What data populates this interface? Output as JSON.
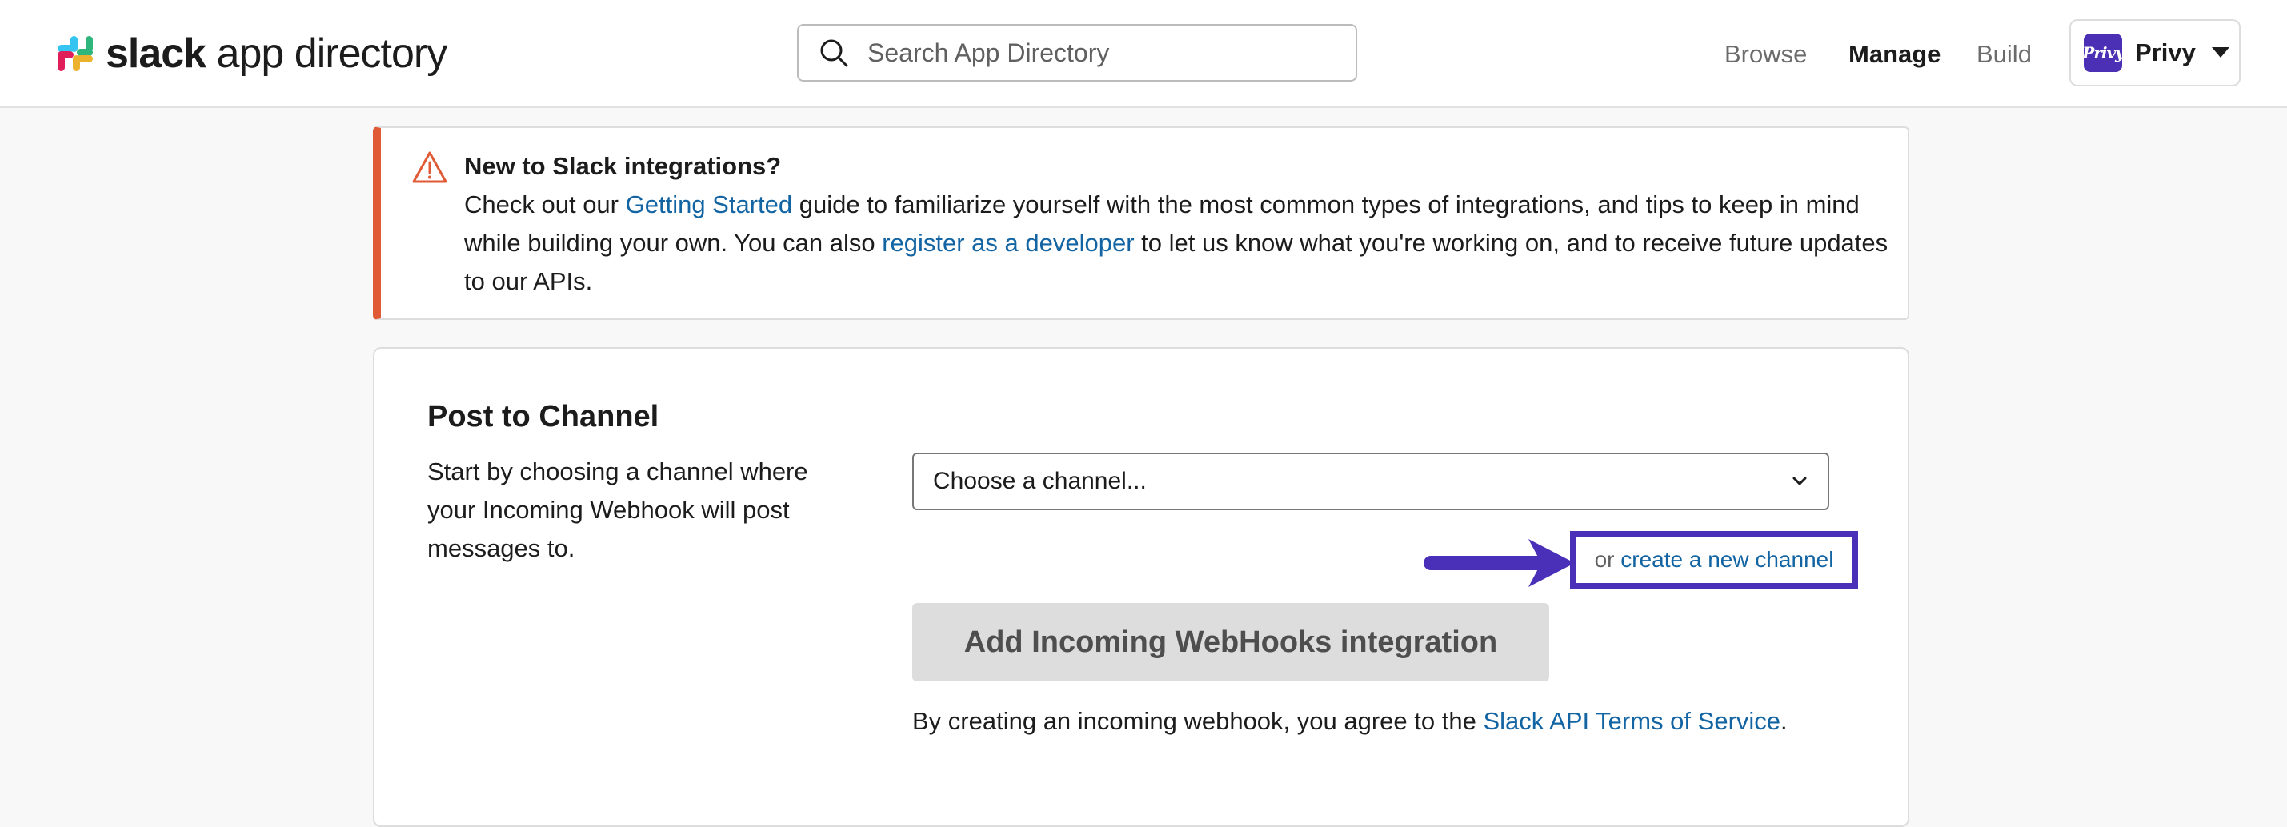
{
  "header": {
    "brand_bold": "slack",
    "brand_rest": " app directory",
    "search_placeholder": "Search App Directory",
    "nav": {
      "browse": "Browse",
      "manage": "Manage",
      "build": "Build",
      "active": "manage"
    },
    "workspace": {
      "avatar_text": "Privy",
      "name": "Privy"
    }
  },
  "alert": {
    "title": "New to Slack integrations?",
    "text_1": "Check out our ",
    "link_getting_started": "Getting Started",
    "text_2": " guide to familiarize yourself with the most common types of integrations, and tips to keep in mind while building your own. You can also ",
    "link_register": "register as a developer",
    "text_3": " to let us know what you're working on, and to receive future updates to our APIs.",
    "accent_color": "#e05a35"
  },
  "post_to_channel": {
    "title": "Post to Channel",
    "description": "Start by choosing a channel where your Incoming Webhook will post messages to.",
    "select_placeholder": "Choose a channel...",
    "create_prefix": "or ",
    "create_link": "create a new channel",
    "add_button": "Add Incoming WebHooks integration",
    "terms_prefix": "By creating an incoming webhook, you agree to the ",
    "terms_link": "Slack API Terms of Service",
    "terms_suffix": "."
  },
  "colors": {
    "link": "#1264a3",
    "highlight": "#4a2fb8",
    "workspace_avatar": "#4b2fb5",
    "button_disabled": "#dddddd"
  },
  "icons": {
    "brand": "slack-logo-icon",
    "search": "search-icon",
    "caret": "caret-down-icon",
    "warning": "warning-triangle-icon",
    "chevron": "chevron-down-icon",
    "arrow": "arrow-right-icon"
  }
}
